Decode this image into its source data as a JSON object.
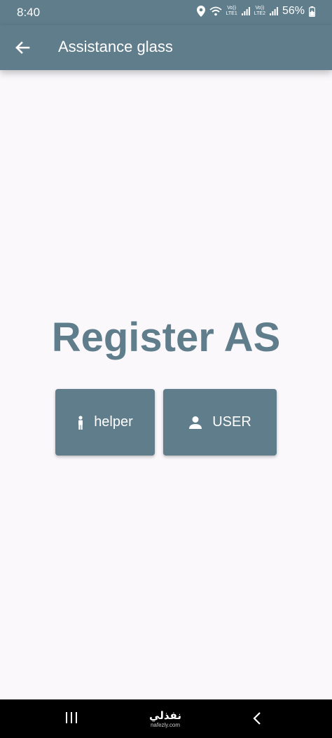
{
  "status_bar": {
    "time": "8:40",
    "sim1_top": "Vo))",
    "sim1_bottom": "LTE1",
    "sim2_top": "Vo))",
    "sim2_bottom": "LTE2",
    "battery": "56%"
  },
  "app_bar": {
    "title": "Assistance glass",
    "back_icon": "arrow-left-icon"
  },
  "main": {
    "heading": "Register AS",
    "buttons": [
      {
        "label": "helper",
        "icon": "person-standing-icon"
      },
      {
        "label": "USER",
        "icon": "person-icon"
      }
    ]
  },
  "nav_bar": {
    "watermark_logo": "نفذلي",
    "watermark_url": "nafezly.com"
  },
  "colors": {
    "primary": "#607d8b",
    "background": "#faf8fb",
    "nav_background": "#000000"
  }
}
